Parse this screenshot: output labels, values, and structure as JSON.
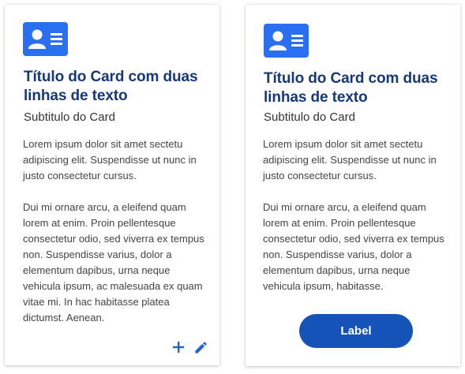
{
  "colors": {
    "icon_background": "#2a6ff0",
    "title": "#16387a",
    "action_icon": "#1f63d6",
    "button_background": "#1653b8",
    "button_text": "#ffffff"
  },
  "cards": [
    {
      "icon": "contact-card-icon",
      "title": "Título do Card com duas linhas de texto",
      "subtitle": "Subtitulo do Card",
      "paragraphs": [
        "Lorem ipsum dolor sit amet sectetu adipiscing elit. Suspendisse ut nunc in justo consectetur cursus.",
        "Dui mi ornare arcu, a eleifend quam lorem at enim. Proin pellentesque consectetur odio, sed viverra ex tempus non. Suspendisse varius, dolor a elementum dapibus, urna neque vehicula ipsum, ac malesuada ex quam vitae mi. In hac habitasse platea dictumst. Aenean."
      ],
      "actions": [
        {
          "icon": "plus-icon"
        },
        {
          "icon": "pencil-icon"
        }
      ]
    },
    {
      "icon": "contact-card-icon",
      "title": "Título do Card com duas linhas de texto",
      "subtitle": "Subtitulo do Card",
      "paragraphs": [
        "Lorem ipsum dolor sit amet sectetu adipiscing elit. Suspendisse ut nunc in justo consectetur cursus.",
        "Dui mi ornare arcu, a eleifend quam lorem at enim. Proin pellentesque consectetur odio, sed viverra ex tempus non. Suspendisse varius, dolor a elementum dapibus, urna neque vehicula ipsum, habitasse."
      ],
      "button_label": "Label"
    }
  ]
}
